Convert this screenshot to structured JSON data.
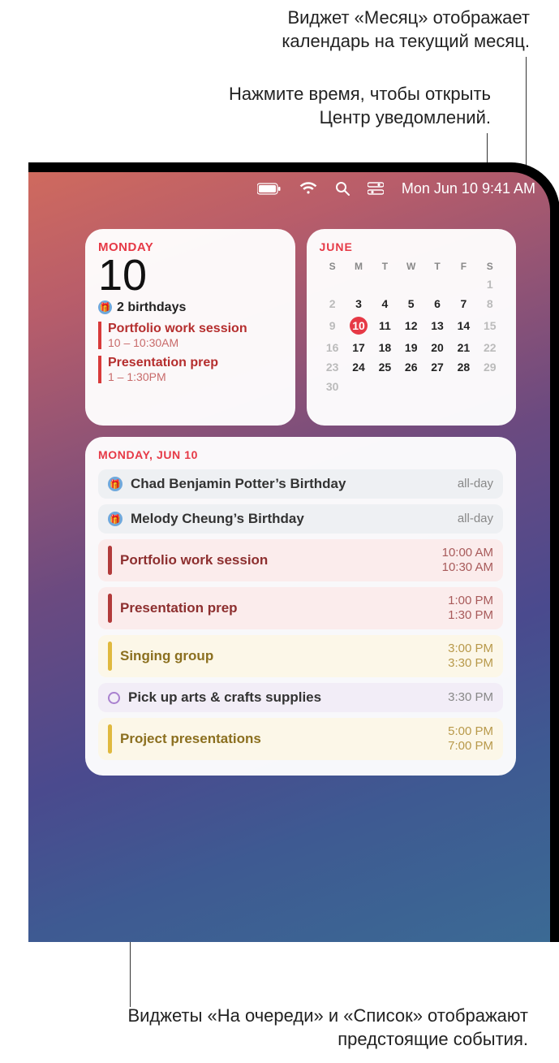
{
  "callouts": {
    "month": "Виджет «Месяц» отображает календарь на текущий месяц.",
    "time": "Нажмите время, чтобы открыть Центр уведомлений.",
    "list": "Виджеты «На очереди» и «Список» отображают предстоящие события."
  },
  "menubar": {
    "datetime": "Mon Jun 10  9:41 AM"
  },
  "upnext": {
    "weekday": "MONDAY",
    "date": "10",
    "birthdays": "2 birthdays",
    "events": [
      {
        "title": "Portfolio work session",
        "sub": "10 – 10:30AM"
      },
      {
        "title": "Presentation prep",
        "sub": "1 – 1:30PM"
      }
    ]
  },
  "month": {
    "title": "JUNE",
    "dow": [
      "S",
      "M",
      "T",
      "W",
      "T",
      "F",
      "S"
    ],
    "weeks": [
      [
        "",
        "",
        "",
        "",
        "",
        "",
        "1"
      ],
      [
        "2",
        "3",
        "4",
        "5",
        "6",
        "7",
        "8"
      ],
      [
        "9",
        "10",
        "11",
        "12",
        "13",
        "14",
        "15"
      ],
      [
        "16",
        "17",
        "18",
        "19",
        "20",
        "21",
        "22"
      ],
      [
        "23",
        "24",
        "25",
        "26",
        "27",
        "28",
        "29"
      ],
      [
        "30",
        "",
        "",
        "",
        "",
        "",
        ""
      ]
    ],
    "today": "10"
  },
  "list": {
    "header": "MONDAY, JUN 10",
    "events": [
      {
        "kind": "bday",
        "title": "Chad Benjamin Potter’s Birthday",
        "time": "all-day"
      },
      {
        "kind": "bday",
        "title": "Melody Cheung’s Birthday",
        "time": "all-day"
      },
      {
        "kind": "red",
        "title": "Portfolio work session",
        "t1": "10:00 AM",
        "t2": "10:30 AM"
      },
      {
        "kind": "red",
        "title": "Presentation prep",
        "t1": "1:00 PM",
        "t2": "1:30 PM"
      },
      {
        "kind": "yellow",
        "title": "Singing group",
        "t1": "3:00 PM",
        "t2": "3:30 PM"
      },
      {
        "kind": "purple",
        "title": "Pick up arts & crafts supplies",
        "time": "3:30 PM"
      },
      {
        "kind": "yellow",
        "title": "Project presentations",
        "t1": "5:00 PM",
        "t2": "7:00 PM"
      }
    ]
  }
}
